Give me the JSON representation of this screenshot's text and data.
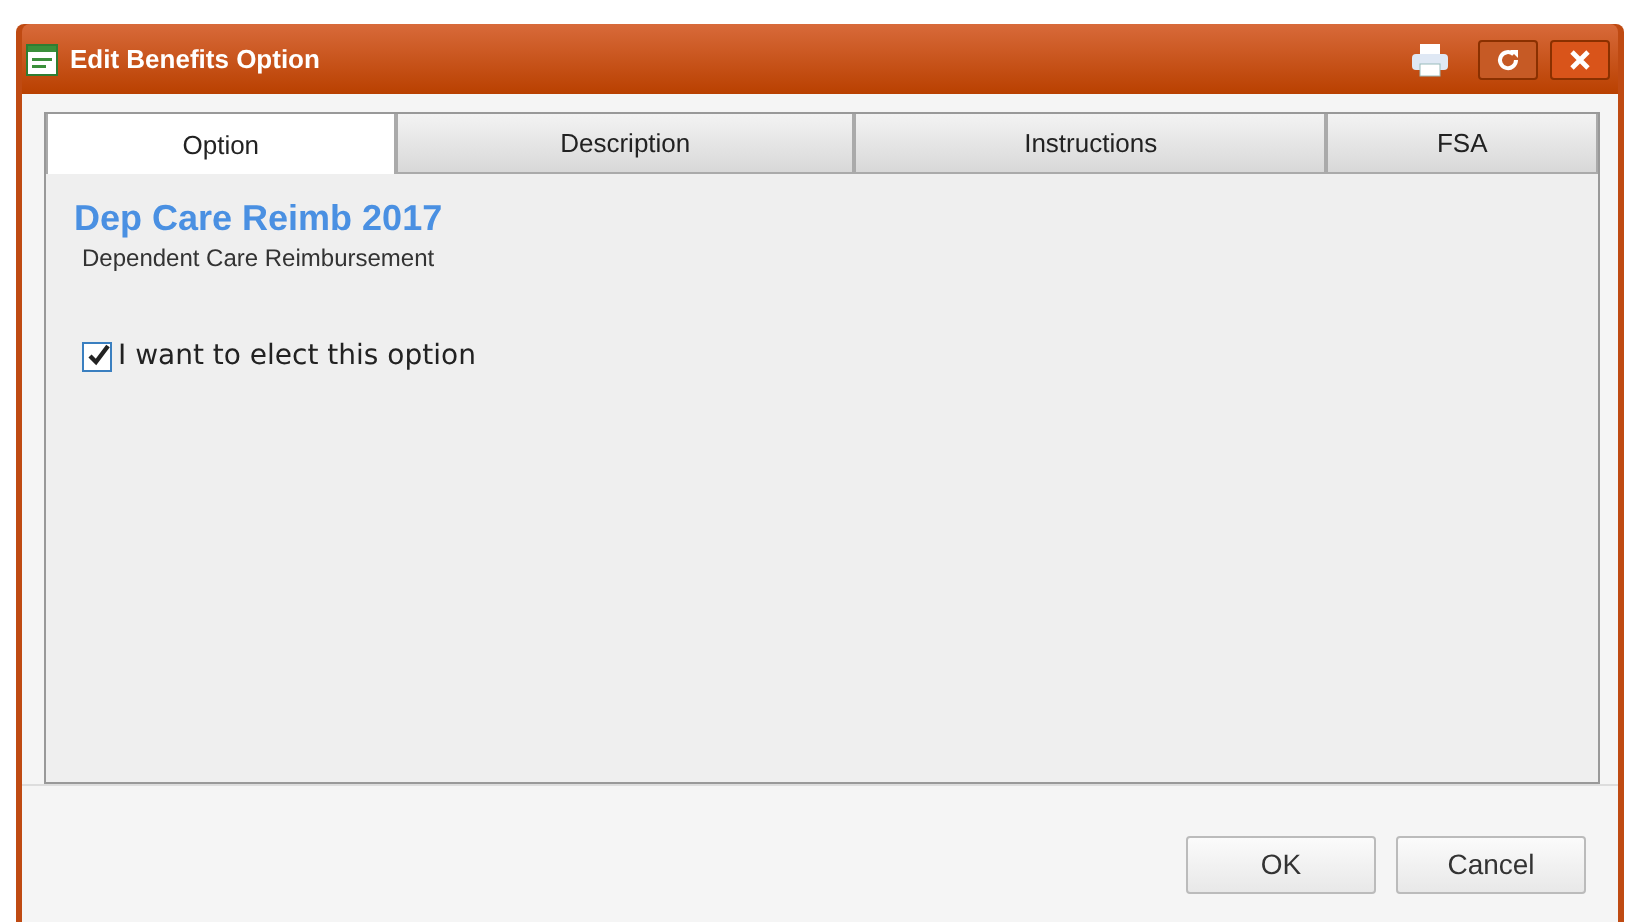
{
  "window": {
    "title": "Edit Benefits Option"
  },
  "tabs": [
    {
      "label": "Option",
      "selected": true
    },
    {
      "label": "Description",
      "selected": false
    },
    {
      "label": "Instructions",
      "selected": false
    },
    {
      "label": "FSA",
      "selected": false
    }
  ],
  "option": {
    "title": "Dep Care Reimb 2017",
    "subtitle": "Dependent Care Reimbursement"
  },
  "elect": {
    "label": "I want to elect this option",
    "checked": true
  },
  "buttons": [
    "OK",
    "Cancel"
  ]
}
